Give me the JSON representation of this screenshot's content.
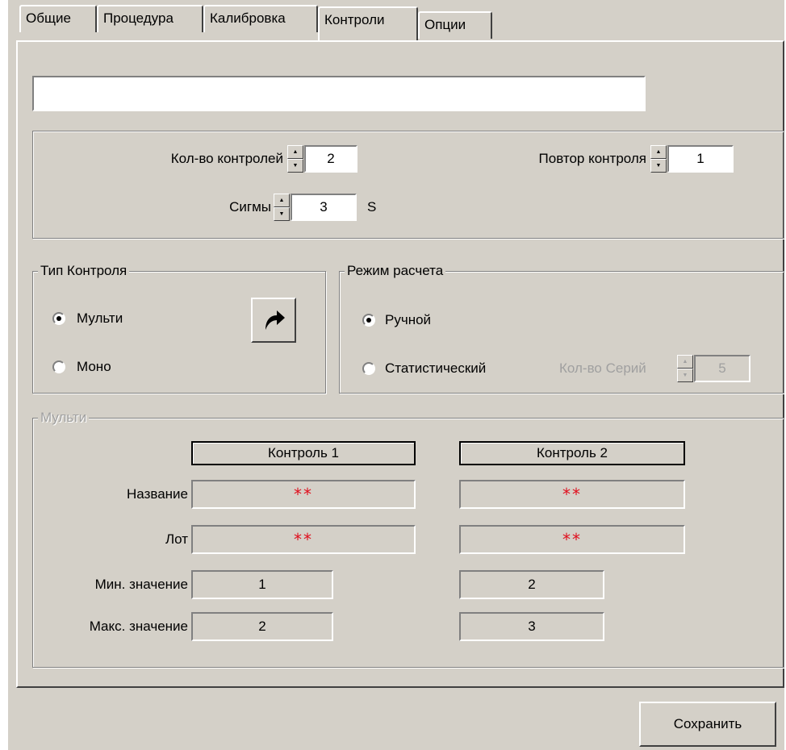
{
  "tabs": [
    "Общие",
    "Процедура",
    "Калибровка",
    "Контроли",
    "Опции"
  ],
  "name_field": {
    "value": ""
  },
  "params": {
    "count_label": "Кол-во контролей",
    "count_value": "2",
    "repeat_label": "Повтор контроля",
    "repeat_value": "1",
    "sigma_label": "Сигмы",
    "sigma_value": "3",
    "sigma_unit": "S"
  },
  "control_type": {
    "title": "Тип Контроля",
    "multi": "Мульти",
    "mono": "Моно",
    "selected": "Мульти",
    "action_icon": "redo-arrow-icon"
  },
  "calc_mode": {
    "title": "Режим расчета",
    "manual": "Ручной",
    "statistical": "Статистический",
    "selected": "Ручной",
    "series_label": "Кол-во Серий",
    "series_value": "5"
  },
  "multi": {
    "title": "Мульти",
    "headers": [
      "Контроль 1",
      "Контроль 2"
    ],
    "row_labels": {
      "name": "Название",
      "lot": "Лот",
      "min": "Мин. значение",
      "max": "Макс. значение"
    },
    "control1": {
      "name": "**",
      "lot": "**",
      "min": "1",
      "max": "2"
    },
    "control2": {
      "name": "**",
      "lot": "**",
      "min": "2",
      "max": "3"
    }
  },
  "save_label": "Сохранить"
}
